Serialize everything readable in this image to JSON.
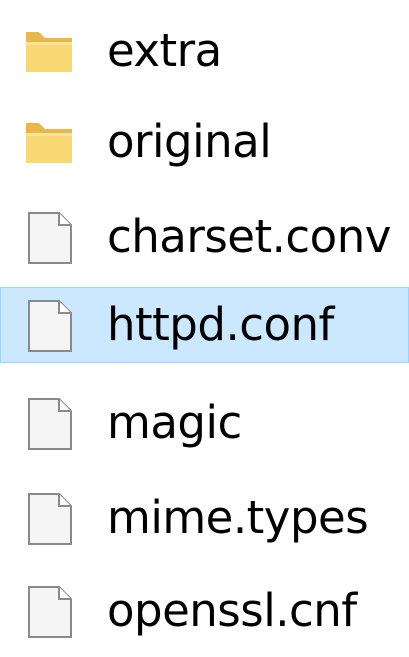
{
  "explorer": {
    "items": [
      {
        "name": "extra",
        "type": "folder",
        "icon": "folder-icon",
        "selected": false
      },
      {
        "name": "original",
        "type": "folder",
        "icon": "folder-icon",
        "selected": false
      },
      {
        "name": "charset.conv",
        "type": "file",
        "icon": "file-icon",
        "selected": false
      },
      {
        "name": "httpd.conf",
        "type": "file",
        "icon": "file-icon",
        "selected": true
      },
      {
        "name": "magic",
        "type": "file",
        "icon": "file-icon",
        "selected": false
      },
      {
        "name": "mime.types",
        "type": "file",
        "icon": "file-icon",
        "selected": false
      },
      {
        "name": "openssl.cnf",
        "type": "file",
        "icon": "file-icon",
        "selected": false
      }
    ]
  },
  "colors": {
    "selection_background": "#cce8ff",
    "selection_border": "#99d1ff",
    "folder": "#f8d775",
    "file_fill": "#f5f5f5",
    "file_stroke": "#8a8a8a"
  }
}
